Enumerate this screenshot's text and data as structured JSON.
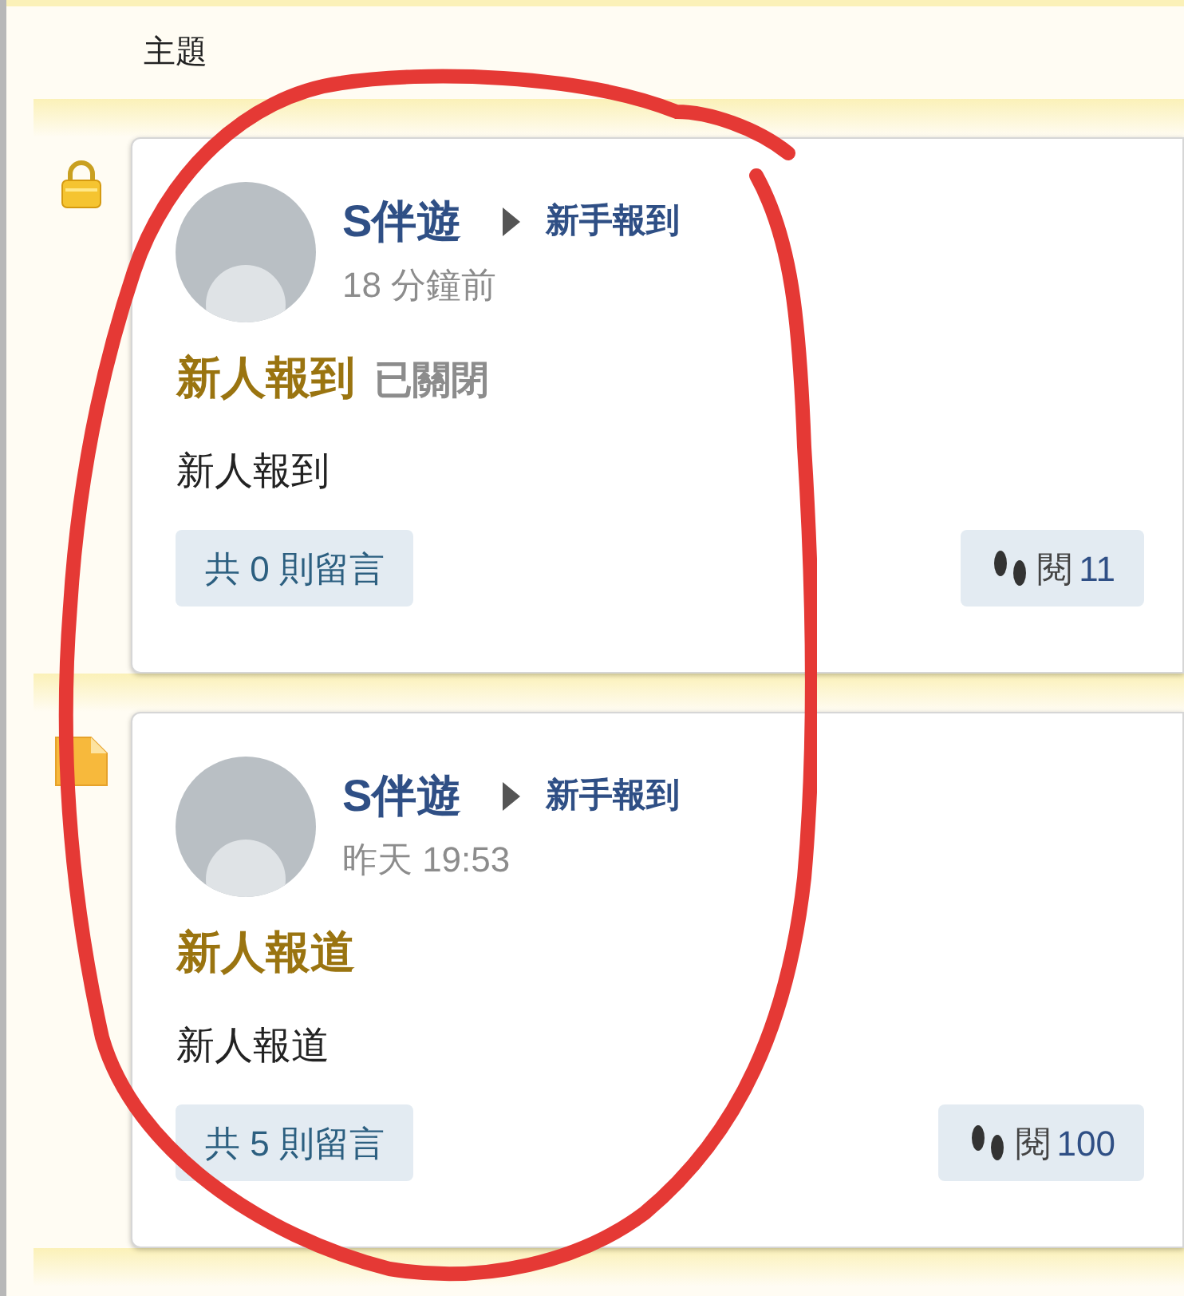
{
  "header": {
    "label": "主題"
  },
  "topics": [
    {
      "kind": "locked",
      "author": "S伴遊",
      "forum": "新手報到",
      "time": "18 分鐘前",
      "title": "新人報到",
      "status_label": "已關閉",
      "body": "新人報到",
      "comments": "共 0 則留言",
      "views_label": "閱",
      "views": "11"
    },
    {
      "kind": "note",
      "author": "S伴遊",
      "forum": "新手報到",
      "time": "昨天 19:53",
      "title": "新人報道",
      "body": "新人報道",
      "comments": "共 5 則留言",
      "views_label": "閱",
      "views": "100"
    }
  ]
}
